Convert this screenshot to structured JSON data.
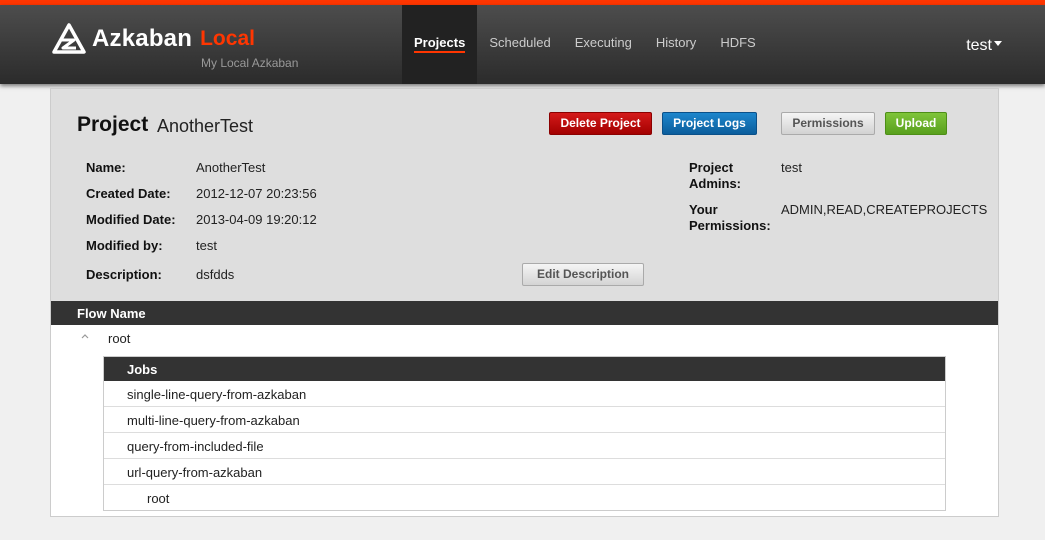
{
  "brand": {
    "name": "Azkaban",
    "env": "Local",
    "subtitle": "My Local Azkaban"
  },
  "nav": {
    "items": [
      {
        "label": "Projects",
        "active": true
      },
      {
        "label": "Scheduled",
        "active": false
      },
      {
        "label": "Executing",
        "active": false
      },
      {
        "label": "History",
        "active": false
      },
      {
        "label": "HDFS",
        "active": false
      }
    ],
    "user": "test"
  },
  "project": {
    "title_prefix": "Project",
    "name": "AnotherTest",
    "buttons": {
      "delete": "Delete Project",
      "logs": "Project Logs",
      "permissions": "Permissions",
      "upload": "Upload",
      "edit_description": "Edit Description"
    },
    "details": {
      "name_label": "Name:",
      "name": "AnotherTest",
      "created_label": "Created Date:",
      "created": "2012-12-07 20:23:56",
      "modified_label": "Modified Date:",
      "modified": "2013-04-09 19:20:12",
      "modified_by_label": "Modified by:",
      "modified_by": "test",
      "description_label": "Description:",
      "description": "dsfdds",
      "admins_label_1": "Project",
      "admins_label_2": "Admins:",
      "admins": "test",
      "permissions_label_1": "Your",
      "permissions_label_2": "Permissions:",
      "permissions": "ADMIN,READ,CREATEPROJECTS"
    }
  },
  "flows": {
    "header": "Flow Name",
    "items": [
      {
        "name": "root",
        "jobs_header": "Jobs",
        "jobs": [
          {
            "name": "single-line-query-from-azkaban"
          },
          {
            "name": "multi-line-query-from-azkaban"
          },
          {
            "name": "query-from-included-file"
          },
          {
            "name": "url-query-from-azkaban"
          },
          {
            "name": "root"
          }
        ]
      }
    ]
  },
  "colors": {
    "accent": "#ff3601",
    "delete": "#c00000",
    "logs": "#1574b8",
    "upload": "#6cb42a",
    "navbar": "#3a3a3a"
  }
}
